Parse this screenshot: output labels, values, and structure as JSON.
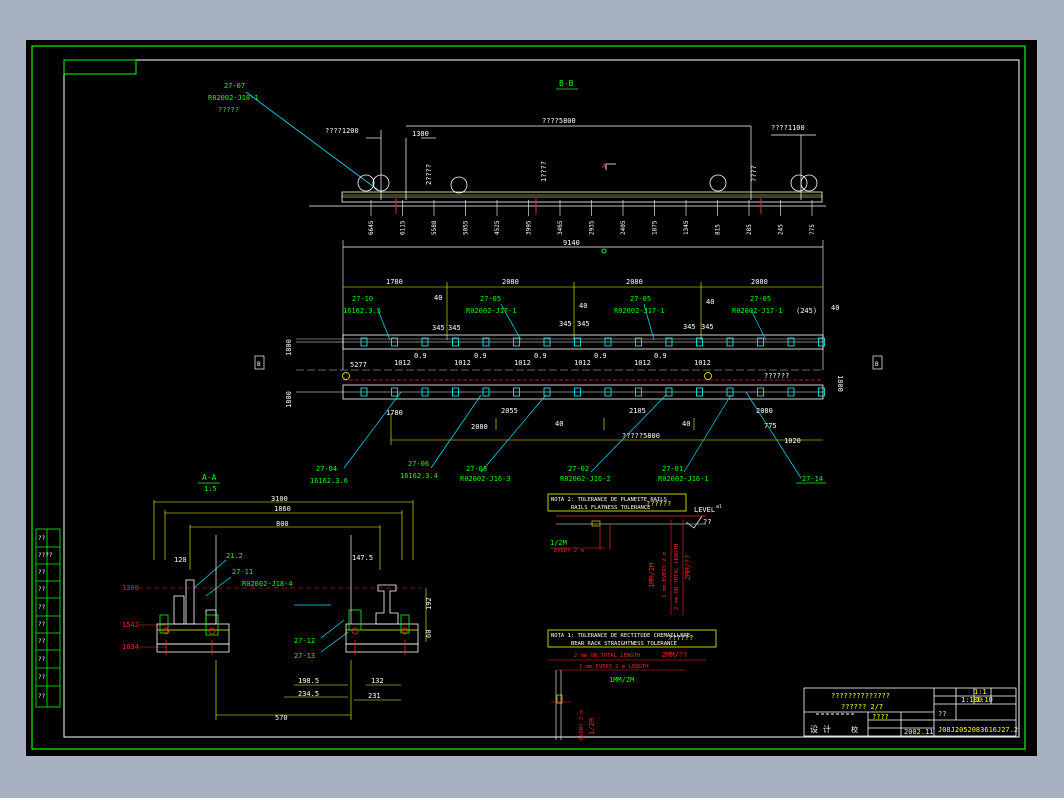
{
  "colors": {
    "background": "#a8b1c1",
    "sheet": "#000000",
    "frame": "#00ff00",
    "dim": "#ffffff",
    "leader": "#00e5ff",
    "accent": "#ff2020",
    "yellow": "#ffff00",
    "cyan": "#00ffff"
  },
  "drawing": {
    "section_bb": "B-B",
    "top_arrow_a": "A",
    "top_label_27_07": "27-07",
    "top_label_r0": "R02002-J18-1",
    "top_label_q": "?????",
    "dim_1200": "????1200",
    "dim_1380": "1380",
    "dim_5800": "????5800",
    "dim_1100": "????1100",
    "vert_1": "2????",
    "vert_2": "1????",
    "vert_3": "????",
    "tick_labels": [
      "6645",
      "6115",
      "5588",
      "5055",
      "4525",
      "3995",
      "3465",
      "2935",
      "2405",
      "1875",
      "1345",
      "815",
      "285",
      "245",
      "775"
    ],
    "plan_total": "9140",
    "plan_1780": "1780",
    "plan_2080a": "2080",
    "plan_2080b": "2080",
    "plan_2080c": "2080",
    "plan_40s": [
      "40",
      "40",
      "40",
      "40"
    ],
    "plan_345s": [
      "345",
      "345",
      "345",
      "345",
      "345",
      "345"
    ],
    "plan_1012s": [
      "1012",
      "1012",
      "1012",
      "1012",
      "1012",
      "1012"
    ],
    "plan_09s": [
      "0.9",
      "0.9",
      "0.9",
      "0.9",
      "0.9"
    ],
    "plan_5277": "5277",
    "plan_245": "(245)",
    "plan_q": "??????",
    "plan_1780b": "1780",
    "plan_2055": "2055",
    "plan_2105": "2105",
    "plan_2080d": "2080",
    "plan_2080e": "2080",
    "plan_40b": [
      "40",
      "40"
    ],
    "plan_775": "775",
    "plan_1020": "1020",
    "plan_5800": "?????5800",
    "plan_left_1": "1800",
    "plan_left_2": "1800",
    "plan_right": "1800",
    "plan_box_b1": "B",
    "plan_box_b2": "B",
    "plan_labels_top": [
      {
        "code": "27-10",
        "sub": "16162.3.5"
      },
      {
        "code": "27-05",
        "sub": "R02002-J17-1"
      },
      {
        "code": "27-05",
        "sub": "R02002-J17-1"
      },
      {
        "code": "27-05",
        "sub": "R02002-J17-1"
      }
    ],
    "plan_labels_bottom": [
      {
        "code": "27-04",
        "sub": "16162.3.6"
      },
      {
        "code": "27-06",
        "sub": "16162.3.4"
      },
      {
        "code": "27-03",
        "sub": "R02002-J16-3"
      },
      {
        "code": "27-02",
        "sub": "R02002-J16-2"
      },
      {
        "code": "27-01",
        "sub": "R02002-J16-1"
      },
      {
        "code": "27-14",
        "sub": ""
      }
    ],
    "aa_title": "A-A",
    "aa_scale": "1:5",
    "aa_3100": "3100",
    "aa_1860": "1860",
    "aa_800": "800",
    "aa_120": "120",
    "aa_147_5": "147.5",
    "aa_21_2": "21.2",
    "aa_27_11": "27-11",
    "aa_r0": "R02002-J18-4",
    "aa_27_12": "27-12",
    "aa_27_13": "27-13",
    "aa_1300": "1300",
    "aa_1542": "1542",
    "aa_1634": "1634",
    "aa_192": "192",
    "aa_98_5": "198.5",
    "aa_234_5": "234.5",
    "aa_132": "132",
    "aa_231": "231",
    "aa_570": "570",
    "aa_60": "60",
    "note2_l1": "NOTA 2: TOLERANCE DE PLANEITE RAILS",
    "note2_l2": "RAILS FLATNESS TOLERANCE",
    "note2_q": "??????",
    "note2_level": "LEVEL",
    "note2_level2": "??",
    "note2_a": "al",
    "note2_1_2m": "1/2M",
    "note2_every": "EVERY 2 m",
    "note2_v1": "1MM/2M",
    "note2_v2": "1 mm EVERY 2 m",
    "note2_v3": "2 mm ON TOTAL LENGTH",
    "note2_v4": "2MM/??",
    "note1_l1": "NOTA 1: TOLERANCE DE RECTITUDE CREMAILLERE",
    "note1_l2": "BEAR RACK STRAIGHTNESS TOLERANCE",
    "note1_q": "??????",
    "note1_r1": "2 mm ON TOTAL LENGTH",
    "note1_r1b": "2MM/??",
    "note1_r2": "1 mm EVERY 2 m LENGTH",
    "note1_mm": "1MM/2M",
    "note1_v1": "EVERY 2 m",
    "note1_v2": "1/2M",
    "title_block": {
      "title": "??????????????",
      "sub": "??????  2/7",
      "design": "设  计",
      "check": "校",
      "q1": "????",
      "date": "2002.11",
      "number": "1:10",
      "right_top": "1:1",
      "right_code": "1:100",
      "code": "J08J2052083616J27.2",
      "small_q": "??"
    },
    "side_table": [
      "??",
      "????",
      "??",
      "??",
      "??",
      "??",
      "??",
      "??",
      "??",
      "??"
    ]
  }
}
